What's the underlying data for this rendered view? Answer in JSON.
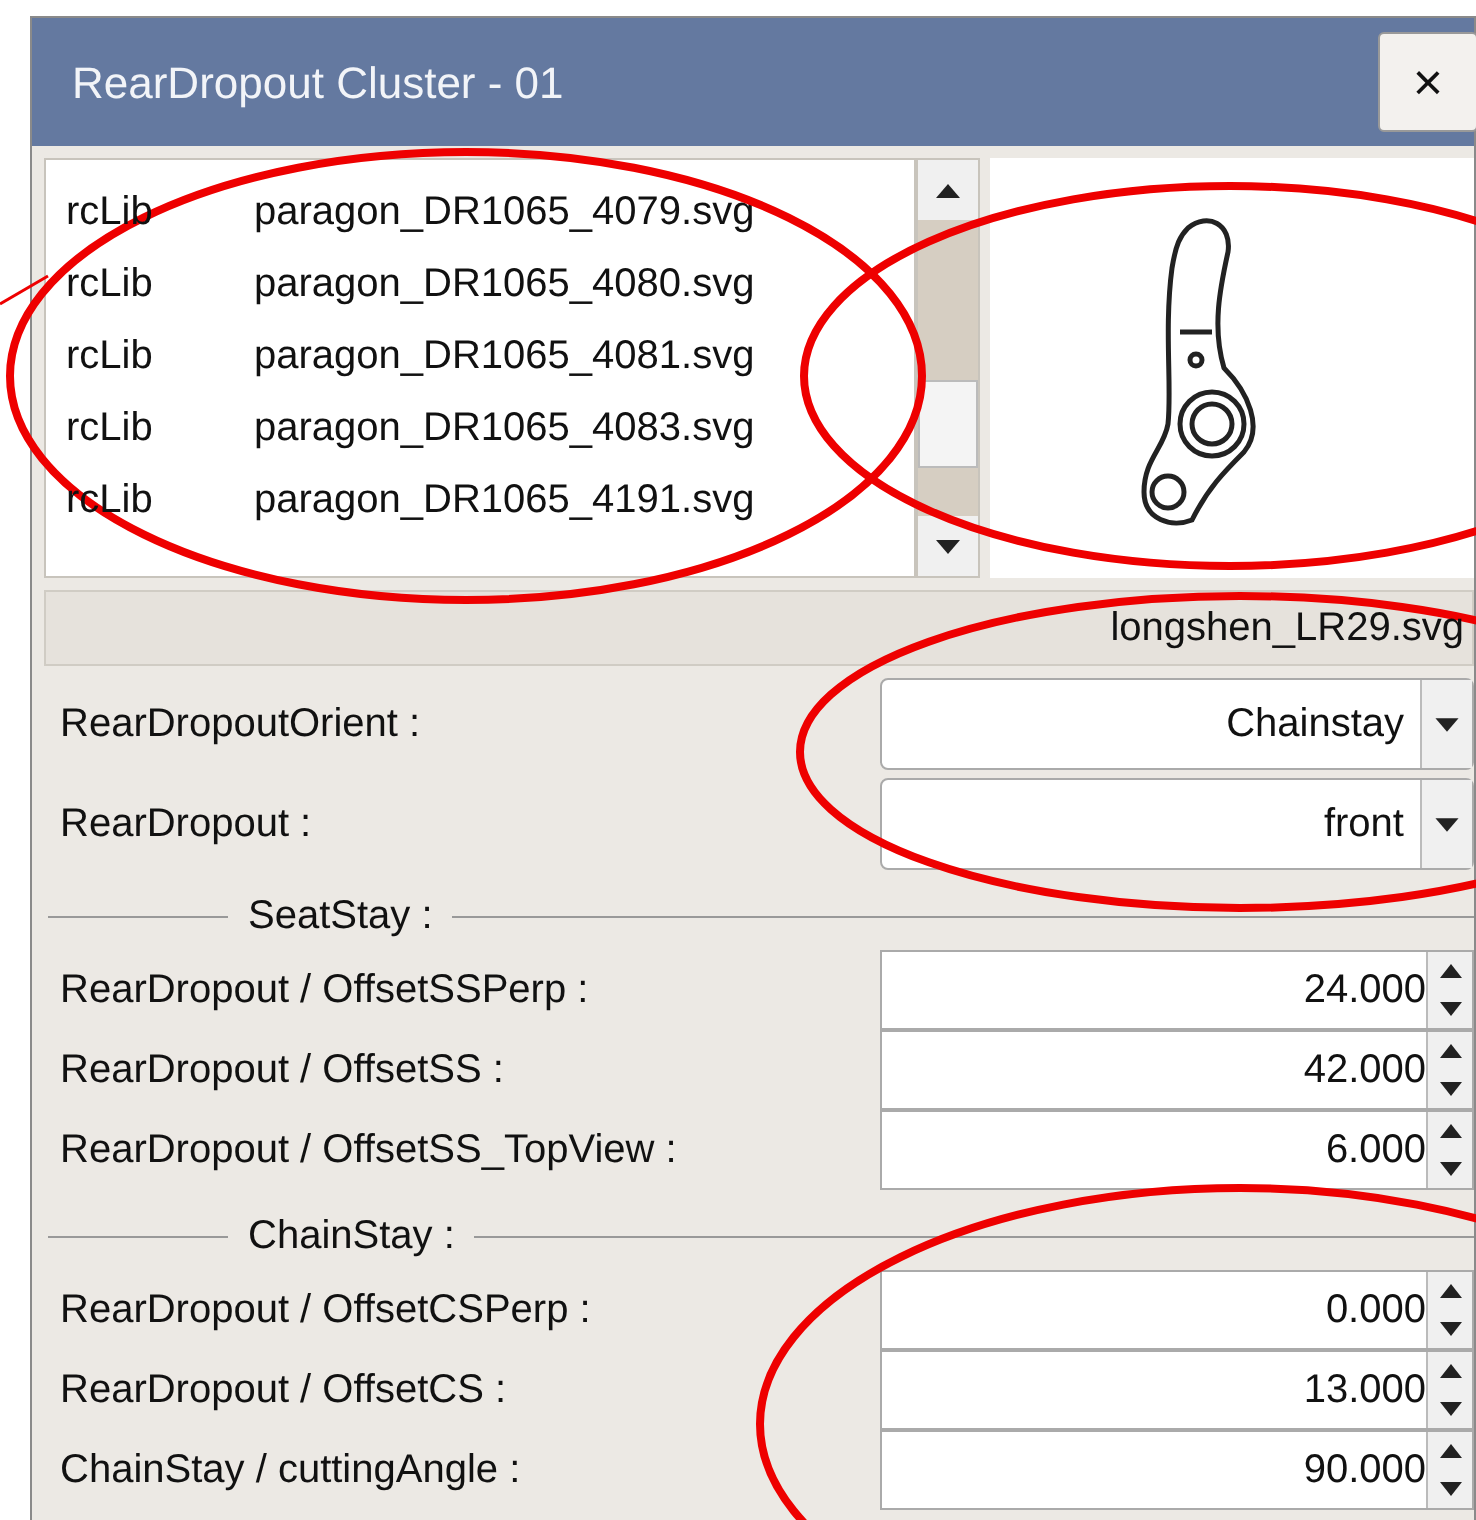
{
  "window": {
    "title": "RearDropout Cluster - 01",
    "close": "×"
  },
  "file_list": [
    {
      "library": "rcLib",
      "file": "paragon_DR1065_4079.svg",
      "selected": false
    },
    {
      "library": "rcLib",
      "file": "paragon_DR1065_4080.svg",
      "selected": false
    },
    {
      "library": "rcLib",
      "file": "paragon_DR1065_4081.svg",
      "selected": false
    },
    {
      "library": "rcLib",
      "file": "paragon_DR1065_4083.svg",
      "selected": false
    },
    {
      "library": "rcLib",
      "file": "paragon_DR1065_4191.svg",
      "selected": false
    }
  ],
  "current_file": "longshen_LR29.svg",
  "combos": [
    {
      "label": "RearDropoutOrient :",
      "value": "Chainstay"
    },
    {
      "label": "RearDropout :",
      "value": "front"
    }
  ],
  "sections": [
    {
      "title": "SeatStay :",
      "fields": [
        {
          "label": "RearDropout / OffsetSSPerp :",
          "value": "24.000"
        },
        {
          "label": "RearDropout / OffsetSS :",
          "value": "42.000"
        },
        {
          "label": "RearDropout / OffsetSS_TopView :",
          "value": "6.000"
        }
      ]
    },
    {
      "title": "ChainStay :",
      "fields": [
        {
          "label": "RearDropout / OffsetCSPerp :",
          "value": "0.000"
        },
        {
          "label": "RearDropout / OffsetCS :",
          "value": "13.000"
        },
        {
          "label": "ChainStay / cuttingAngle :",
          "value": "90.000"
        }
      ]
    }
  ]
}
